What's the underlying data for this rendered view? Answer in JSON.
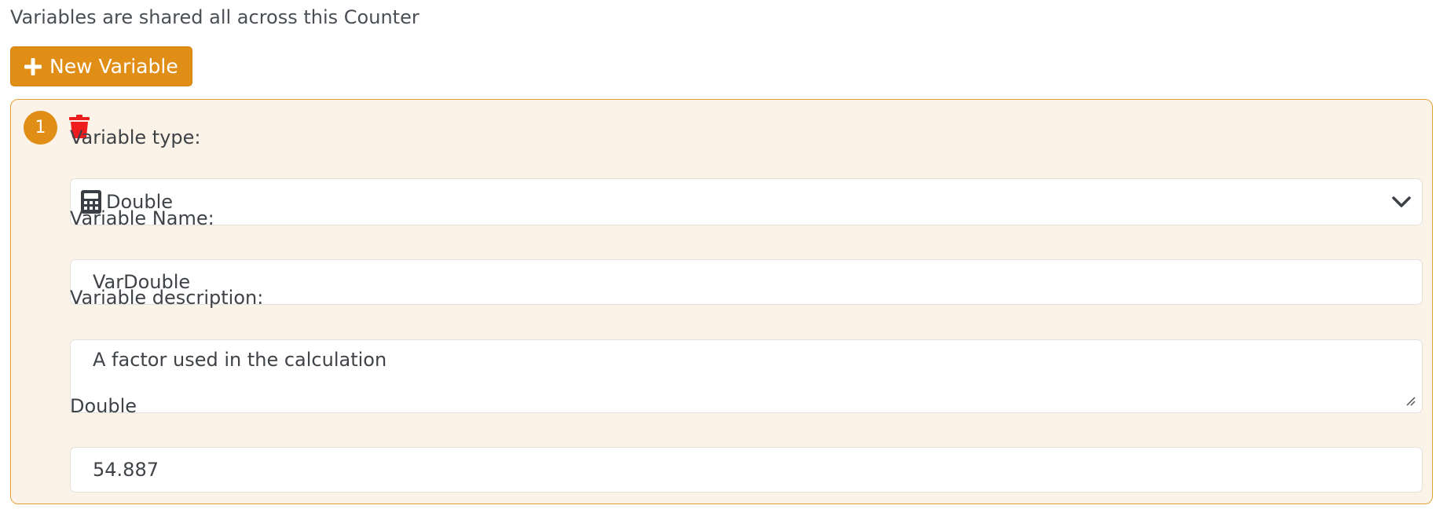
{
  "intro_text": "Variables are shared all across this Counter",
  "new_variable_button": {
    "label": "New Variable",
    "icon": "plus-icon"
  },
  "colors": {
    "accent": "#e08e16",
    "card_bg": "#fbf3e7",
    "card_border": "#e0a238",
    "delete": "#ee1c1c"
  },
  "variables": [
    {
      "index": "1",
      "delete_icon": "trash-icon",
      "type_label": "Variable type:",
      "type_value": "Double",
      "type_icon": "calculator-icon",
      "name_label": "Variable Name:",
      "name_value": "VarDouble",
      "description_label": "Variable description:",
      "description_value": "A factor used in the calculation",
      "value_label": "Double",
      "value": "54.887"
    }
  ]
}
